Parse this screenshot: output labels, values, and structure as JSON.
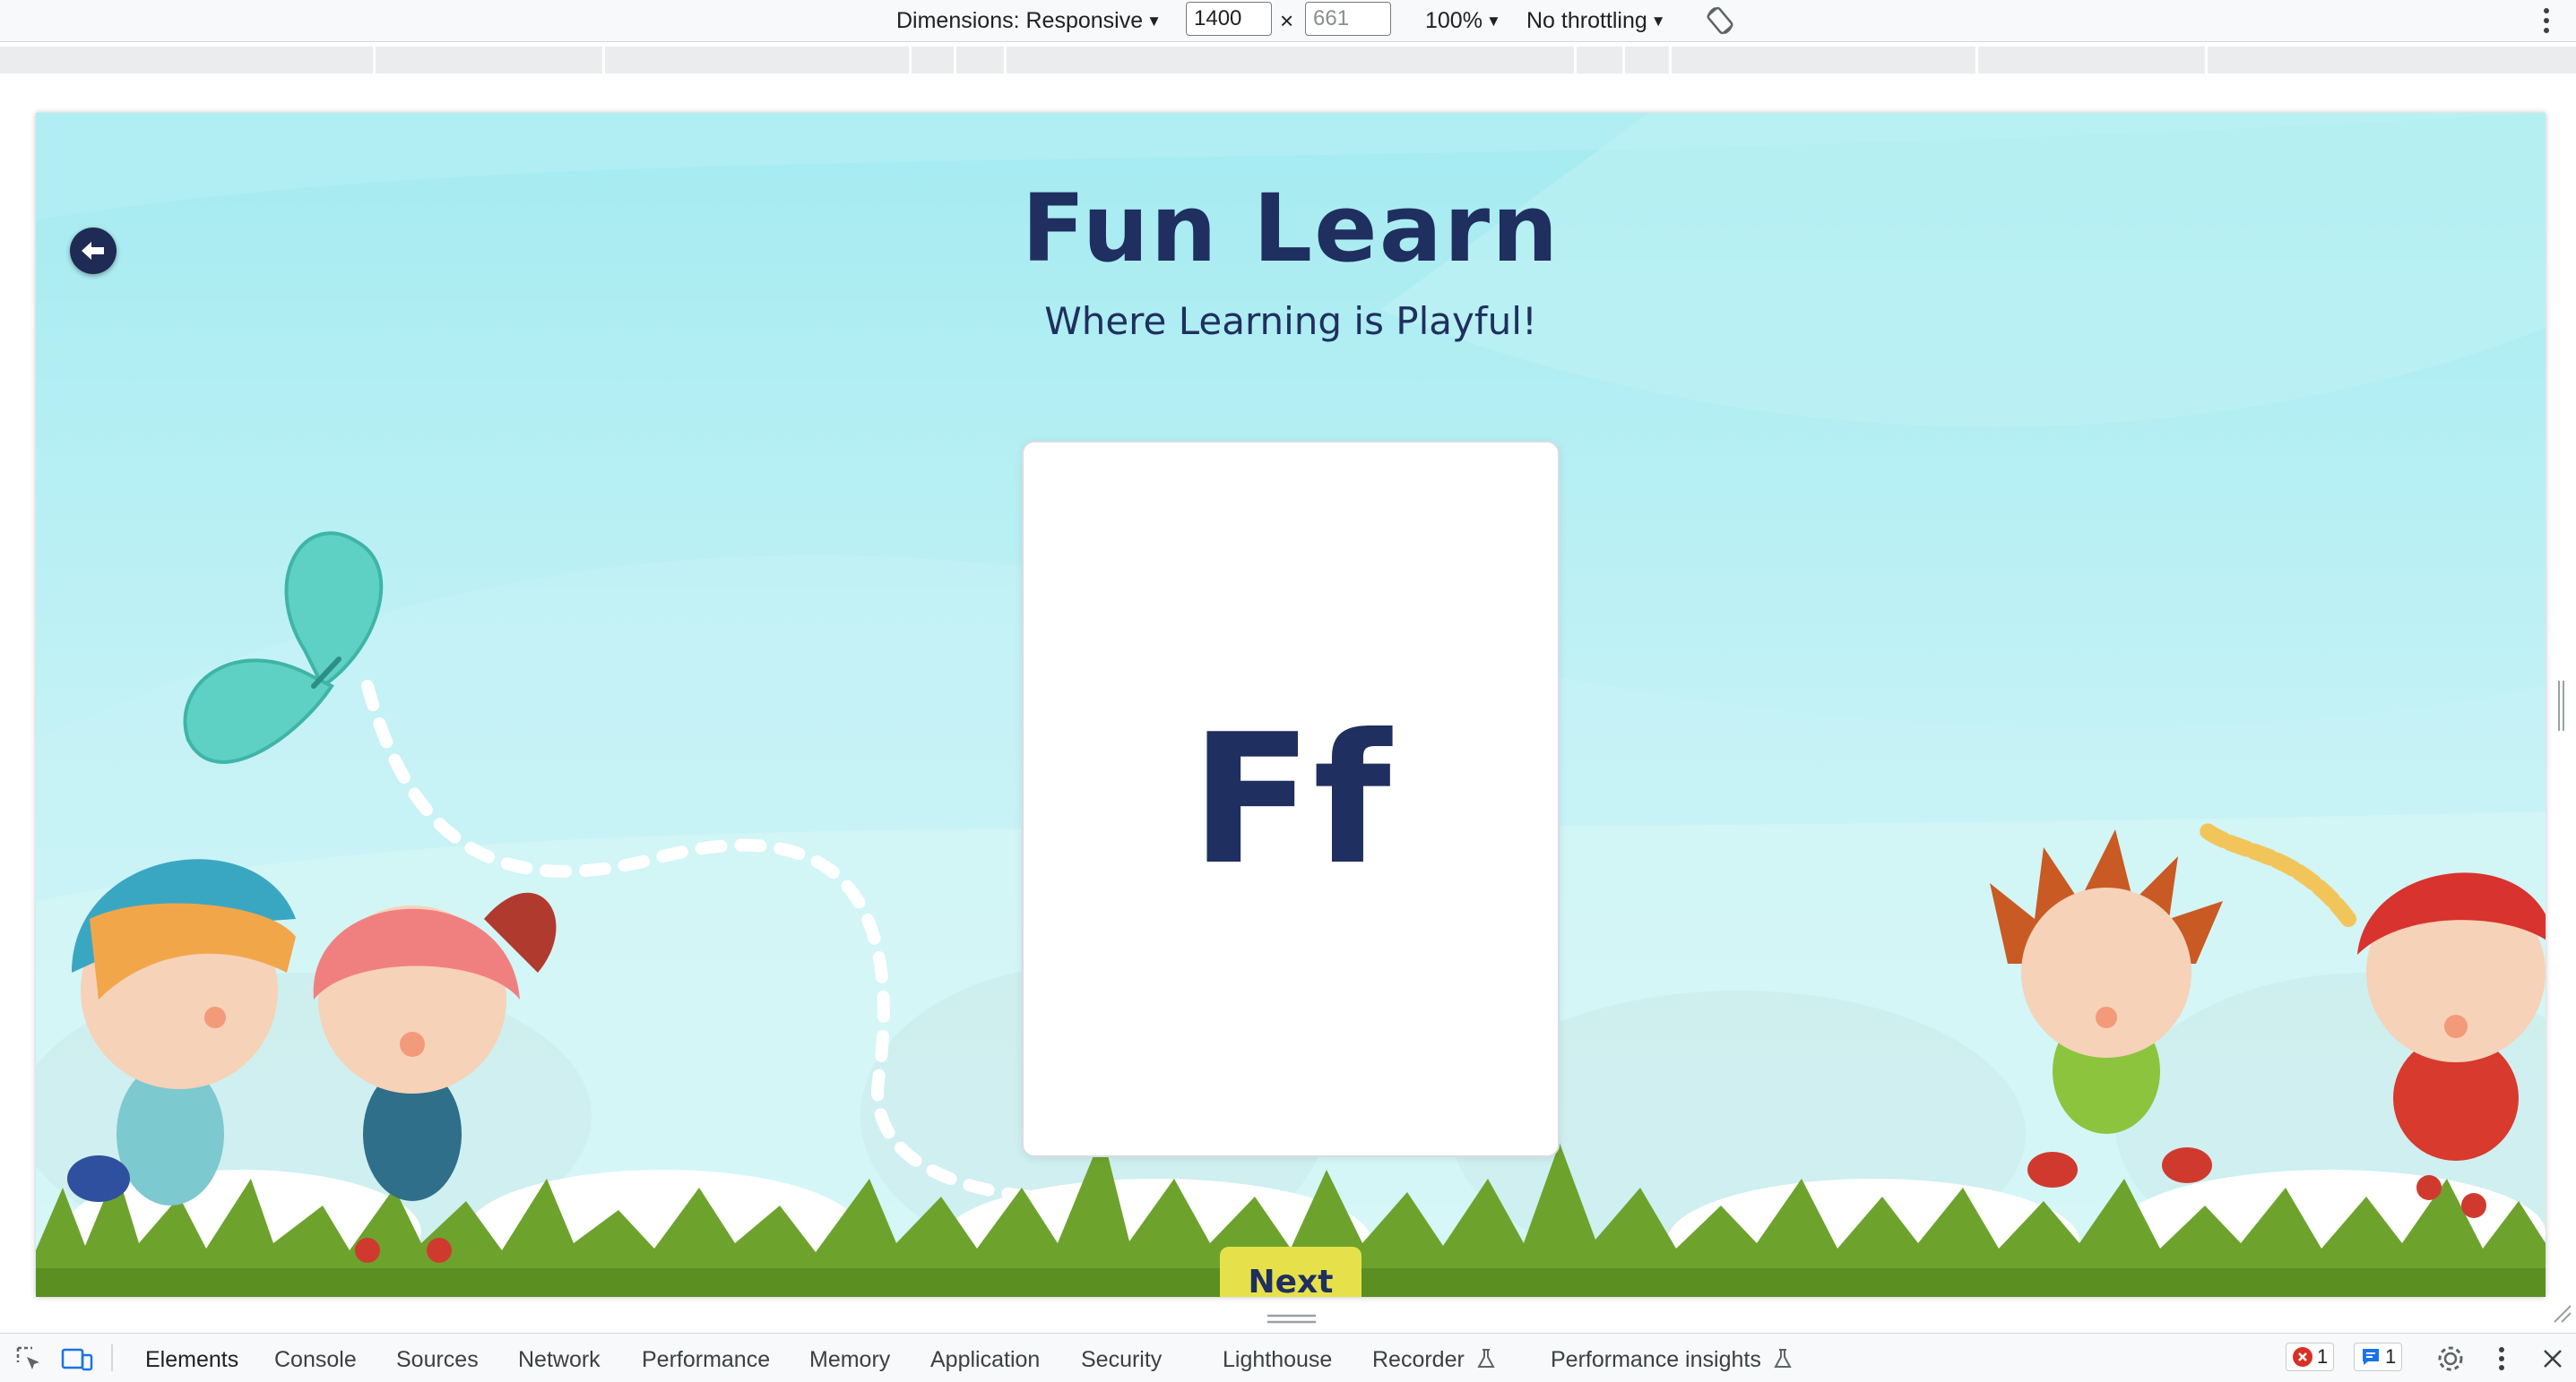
{
  "device_toolbar": {
    "dimensions_label": "Dimensions: Responsive",
    "width_value": "1400",
    "height_placeholder": "661",
    "times": "×",
    "zoom": "100%",
    "throttling": "No throttling"
  },
  "page": {
    "title": "Fun Learn",
    "subtitle": "Where Learning is Playful!",
    "card_letter": "Ff",
    "next_label": "Next"
  },
  "devtools": {
    "tabs": [
      "Elements",
      "Console",
      "Sources",
      "Network",
      "Performance",
      "Memory",
      "Application",
      "Security",
      "Lighthouse",
      "Recorder",
      "Performance insights"
    ],
    "active_tab": "Elements",
    "error_count": "1",
    "message_count": "1"
  },
  "colors": {
    "sky": "#a6ecf2",
    "title": "#1f2f5f",
    "next_button": "#e6e14a",
    "grass": "#6da32d"
  }
}
